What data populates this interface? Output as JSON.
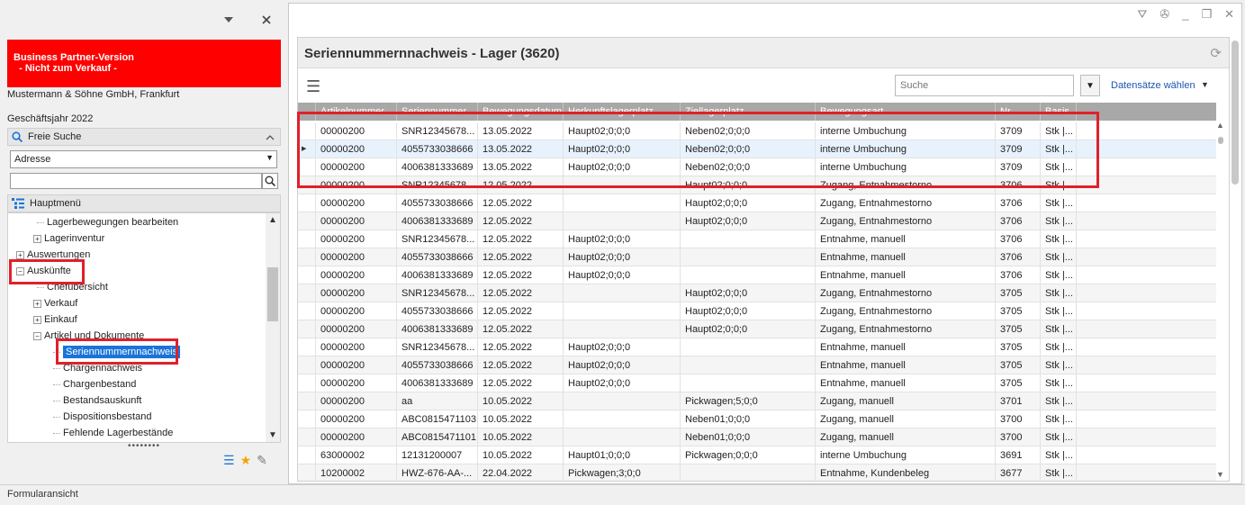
{
  "left": {
    "bp_line1": "Business Partner-Version",
    "bp_line2": "  - Nicht zum Verkauf -",
    "company": "Mustermann & Söhne GmbH, Frankfurt",
    "fiscal_year": "Geschäftsjahr 2022",
    "freie_suche": "Freie Suche",
    "address_select": "Adresse",
    "hauptmenu": "Hauptmenü",
    "tree": [
      {
        "label": "Lagerbewegungen bearbeiten",
        "type": "leaf"
      },
      {
        "label": "Lagerinventur",
        "type": "plus"
      },
      {
        "label": "Auswertungen",
        "type": "plus"
      },
      {
        "label": "Auskünfte",
        "type": "minus"
      },
      {
        "label": "Chefübersicht",
        "type": "leaf"
      },
      {
        "label": "Verkauf",
        "type": "plus"
      },
      {
        "label": "Einkauf",
        "type": "plus"
      },
      {
        "label": "Artikel und Dokumente",
        "type": "minus"
      },
      {
        "label": "Seriennummernnachweis",
        "type": "selected"
      },
      {
        "label": "Chargennachweis",
        "type": "leaf"
      },
      {
        "label": "Chargenbestand",
        "type": "leaf"
      },
      {
        "label": "Bestandsauskunft",
        "type": "leaf"
      },
      {
        "label": "Dispositionsbestand",
        "type": "leaf"
      },
      {
        "label": "Fehlende Lagerbestände",
        "type": "leaf"
      }
    ]
  },
  "right": {
    "title": "Seriennummernnachweis - Lager (3620)",
    "search_placeholder": "Suche",
    "datensaetze": "Datensätze wählen",
    "columns": [
      "",
      "Artikelnummer",
      "Seriennummer",
      "Bewegungsdatum",
      "Herkunftslagerplatz",
      "Ziellagerplatz",
      "Bewegungsart",
      "Nr.",
      "Basis..."
    ],
    "rows": [
      [
        "00000200",
        "SNR12345678...",
        "13.05.2022",
        "Haupt02;0;0;0",
        "Neben02;0;0;0",
        "interne Umbuchung",
        "3709",
        "Stk   |..."
      ],
      [
        "00000200",
        "4055733038666",
        "13.05.2022",
        "Haupt02;0;0;0",
        "Neben02;0;0;0",
        "interne Umbuchung",
        "3709",
        "Stk   |..."
      ],
      [
        "00000200",
        "4006381333689",
        "13.05.2022",
        "Haupt02;0;0;0",
        "Neben02;0;0;0",
        "interne Umbuchung",
        "3709",
        "Stk   |..."
      ],
      [
        "00000200",
        "SNR12345678...",
        "12.05.2022",
        "",
        "Haupt02;0;0;0",
        "Zugang, Entnahmestorno",
        "3706",
        "Stk   |..."
      ],
      [
        "00000200",
        "4055733038666",
        "12.05.2022",
        "",
        "Haupt02;0;0;0",
        "Zugang, Entnahmestorno",
        "3706",
        "Stk   |..."
      ],
      [
        "00000200",
        "4006381333689",
        "12.05.2022",
        "",
        "Haupt02;0;0;0",
        "Zugang, Entnahmestorno",
        "3706",
        "Stk   |..."
      ],
      [
        "00000200",
        "SNR12345678...",
        "12.05.2022",
        "Haupt02;0;0;0",
        "",
        "Entnahme, manuell",
        "3706",
        "Stk   |..."
      ],
      [
        "00000200",
        "4055733038666",
        "12.05.2022",
        "Haupt02;0;0;0",
        "",
        "Entnahme, manuell",
        "3706",
        "Stk   |..."
      ],
      [
        "00000200",
        "4006381333689",
        "12.05.2022",
        "Haupt02;0;0;0",
        "",
        "Entnahme, manuell",
        "3706",
        "Stk   |..."
      ],
      [
        "00000200",
        "SNR12345678...",
        "12.05.2022",
        "",
        "Haupt02;0;0;0",
        "Zugang, Entnahmestorno",
        "3705",
        "Stk   |..."
      ],
      [
        "00000200",
        "4055733038666",
        "12.05.2022",
        "",
        "Haupt02;0;0;0",
        "Zugang, Entnahmestorno",
        "3705",
        "Stk   |..."
      ],
      [
        "00000200",
        "4006381333689",
        "12.05.2022",
        "",
        "Haupt02;0;0;0",
        "Zugang, Entnahmestorno",
        "3705",
        "Stk   |..."
      ],
      [
        "00000200",
        "SNR12345678...",
        "12.05.2022",
        "Haupt02;0;0;0",
        "",
        "Entnahme, manuell",
        "3705",
        "Stk   |..."
      ],
      [
        "00000200",
        "4055733038666",
        "12.05.2022",
        "Haupt02;0;0;0",
        "",
        "Entnahme, manuell",
        "3705",
        "Stk   |..."
      ],
      [
        "00000200",
        "4006381333689",
        "12.05.2022",
        "Haupt02;0;0;0",
        "",
        "Entnahme, manuell",
        "3705",
        "Stk   |..."
      ],
      [
        "00000200",
        "aa",
        "10.05.2022",
        "",
        "Pickwagen;5;0;0",
        "Zugang, manuell",
        "3701",
        "Stk   |..."
      ],
      [
        "00000200",
        "ABC0815471103",
        "10.05.2022",
        "",
        "Neben01;0;0;0",
        "Zugang, manuell",
        "3700",
        "Stk   |..."
      ],
      [
        "00000200",
        "ABC0815471101",
        "10.05.2022",
        "",
        "Neben01;0;0;0",
        "Zugang, manuell",
        "3700",
        "Stk   |..."
      ],
      [
        "63000002",
        "12131200007",
        "10.05.2022",
        "Haupt01;0;0;0",
        "Pickwagen;0;0;0",
        "interne Umbuchung",
        "3691",
        "Stk   |..."
      ],
      [
        "10200002",
        "HWZ-676-AA-...",
        "22.04.2022",
        "Pickwagen;3;0;0",
        "",
        "Entnahme, Kundenbeleg",
        "3677",
        "Stk   |..."
      ]
    ]
  },
  "status": "Formularansicht",
  "colors": {
    "highlight": "#e0202a",
    "brand_red": "#ff0000",
    "selection": "#1a74d8",
    "link": "#1a56b0"
  }
}
